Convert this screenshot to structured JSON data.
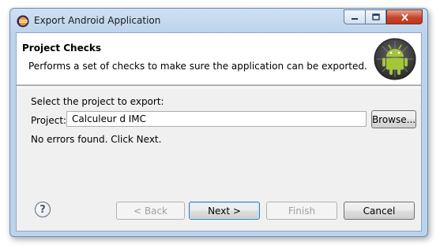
{
  "window": {
    "title": "Export Android Application",
    "icon": "eclipse-icon",
    "controls": {
      "minimize": "minimize-icon",
      "maximize": "maximize-icon",
      "close": "close-icon"
    }
  },
  "header": {
    "title": "Project Checks",
    "description": "Performs a set of checks to make sure the application can be exported.",
    "icon": "android-icon"
  },
  "form": {
    "select_label": "Select the project to export:",
    "project_label": "Project:",
    "project_value": "Calculeur d IMC",
    "browse_label": "Browse..."
  },
  "status": "No errors found. Click Next.",
  "buttons": {
    "help": "?",
    "back": "< Back",
    "next": "Next >",
    "finish": "Finish",
    "cancel": "Cancel"
  }
}
